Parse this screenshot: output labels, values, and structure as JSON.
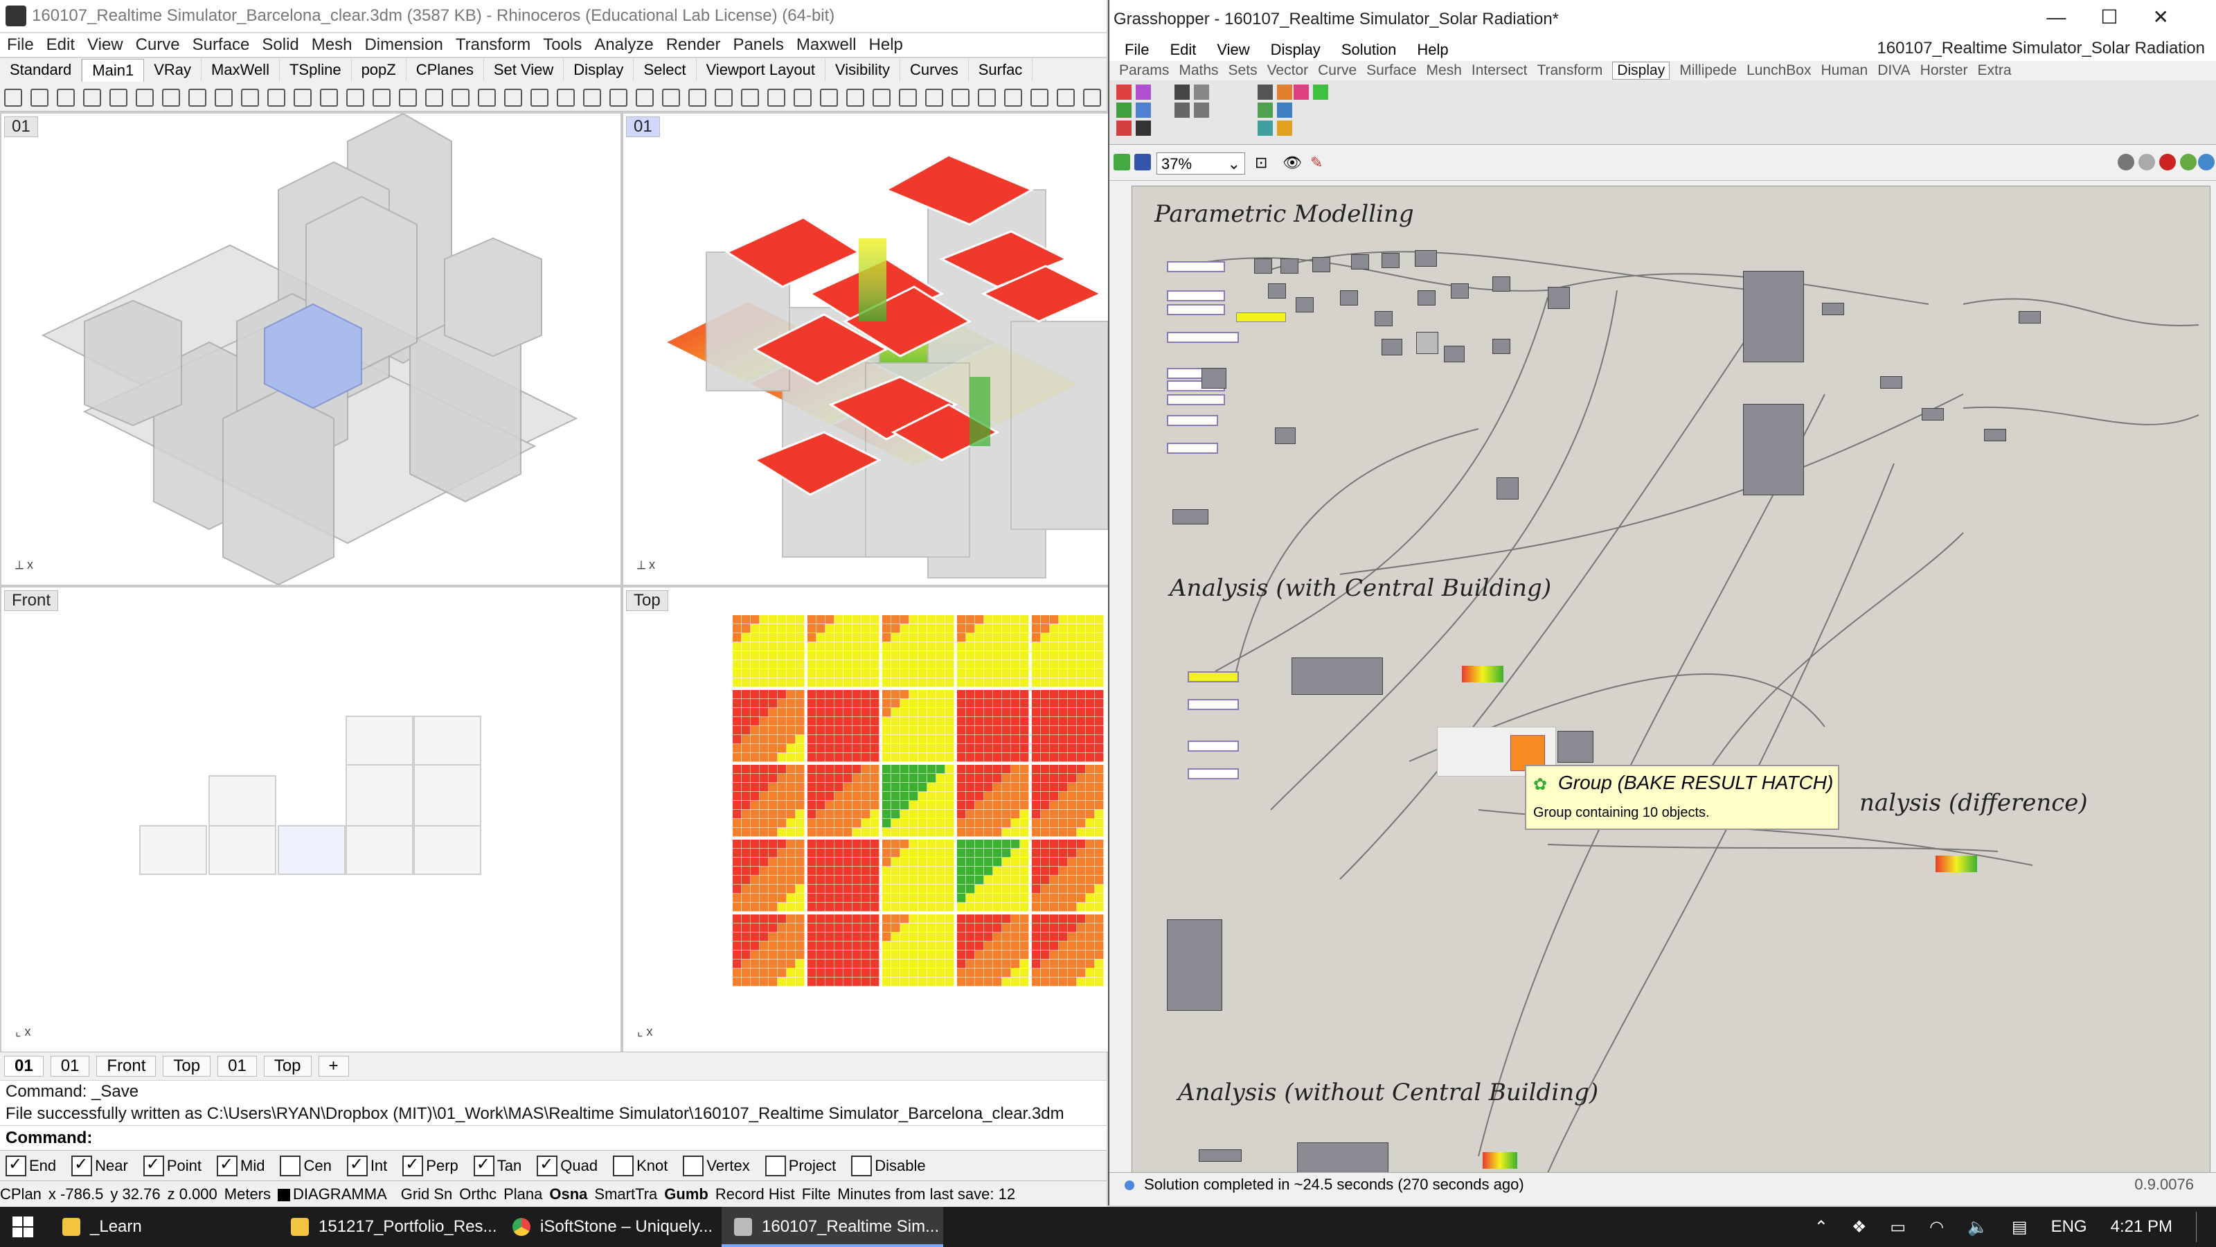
{
  "rhino": {
    "title": "160107_Realtime Simulator_Barcelona_clear.3dm (3587 KB) - Rhinoceros (Educational Lab License) (64-bit)",
    "menu": [
      "File",
      "Edit",
      "View",
      "Curve",
      "Surface",
      "Solid",
      "Mesh",
      "Dimension",
      "Transform",
      "Tools",
      "Analyze",
      "Render",
      "Panels",
      "Maxwell",
      "Help"
    ],
    "tabs": [
      "Standard",
      "Main1",
      "VRay",
      "MaxWell",
      "TSpline",
      "popZ",
      "CPlanes",
      "Set View",
      "Display",
      "Select",
      "Viewport Layout",
      "Visibility",
      "Curves",
      "Surfac"
    ],
    "viewports": {
      "tl": "01",
      "tr": "01",
      "bl": "Front",
      "br": "Top"
    },
    "viewport_tabs": [
      "01",
      "01",
      "Front",
      "Top",
      "01",
      "Top",
      "+"
    ],
    "command_history": [
      "Command: _Save",
      "File successfully written as C:\\Users\\RYAN\\Dropbox (MIT)\\01_Work\\MAS\\Realtime Simulator\\160107_Realtime Simulator_Barcelona_clear.3dm"
    ],
    "command_prompt": "Command:",
    "osnaps": [
      {
        "label": "End",
        "on": true
      },
      {
        "label": "Near",
        "on": true
      },
      {
        "label": "Point",
        "on": true
      },
      {
        "label": "Mid",
        "on": true
      },
      {
        "label": "Cen",
        "on": false
      },
      {
        "label": "Int",
        "on": true
      },
      {
        "label": "Perp",
        "on": true
      },
      {
        "label": "Tan",
        "on": true
      },
      {
        "label": "Quad",
        "on": true
      },
      {
        "label": "Knot",
        "on": false
      },
      {
        "label": "Vertex",
        "on": false
      },
      {
        "label": "Project",
        "on": false
      },
      {
        "label": "Disable",
        "on": false
      }
    ],
    "status": {
      "cplane": "CPlan",
      "x": "x -786.5",
      "y": "y 32.76",
      "z": "z 0.000",
      "units": "Meters",
      "layer": "DIAGRAMMA",
      "grid": "Grid Sn",
      "ortho": "Orthc",
      "planar": "Plana",
      "osnap": "Osna",
      "smarttrack": "SmartTra",
      "gumball": "Gumb",
      "record": "Record Hist",
      "filter": "Filte",
      "save": "Minutes from last save: 12"
    }
  },
  "grasshopper": {
    "title": "Grasshopper - 160107_Realtime Simulator_Solar Radiation*",
    "doc_name": "160107_Realtime Simulator_Solar Radiation",
    "menu": [
      "File",
      "Edit",
      "View",
      "Display",
      "Solution",
      "Help"
    ],
    "tabs": [
      "Params",
      "Maths",
      "Sets",
      "Vector",
      "Curve",
      "Surface",
      "Mesh",
      "Intersect",
      "Transform",
      "Display",
      "Millipede",
      "LunchBox",
      "Human",
      "DIVA",
      "Horster",
      "Extra"
    ],
    "active_tab": "Display",
    "zoom": "37%",
    "groups": [
      "Parametric Modelling",
      "Analysis (with Central Building)",
      "nalysis (difference)",
      "Analysis (without Central Building)"
    ],
    "tooltip": {
      "title": "Group (BAKE RESULT HATCH)",
      "body": "Group containing 10 objects."
    },
    "status": "Solution completed in ~24.5 seconds (270 seconds ago)",
    "version": "0.9.0076"
  },
  "taskbar": {
    "items": [
      "_Learn",
      "151217_Portfolio_Res...",
      "iSoftStone – Uniquely...",
      "160107_Realtime Sim..."
    ],
    "lang": "ENG",
    "time": "4:21 PM"
  },
  "colors": {
    "heat_red": "#f0392b",
    "heat_orange": "#f57f2a",
    "heat_yellow": "#f2f21c",
    "heat_green": "#3cb030",
    "accent_blue": "#a8b8f0"
  }
}
